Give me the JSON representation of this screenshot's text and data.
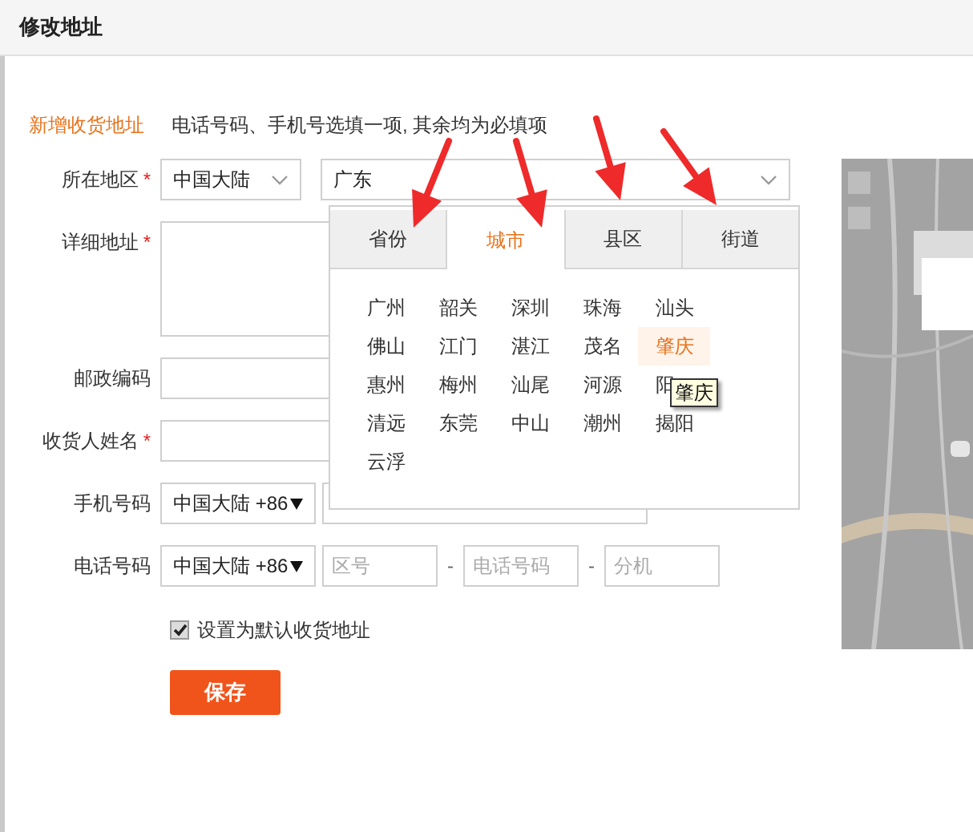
{
  "title": "修改地址",
  "note": {
    "label": "新增收货地址",
    "hint": "电话号码、手机号选填一项, 其余均为必填项"
  },
  "fields": [
    {
      "kind": "region",
      "label": "所在地区",
      "required_mark": "*",
      "country": "中国大陆",
      "province": "广东"
    },
    {
      "kind": "textarea",
      "label": "详细地址",
      "required_mark": "*"
    },
    {
      "kind": "text",
      "label": "邮政编码"
    },
    {
      "kind": "text",
      "label": "收货人姓名",
      "required_mark": "*"
    },
    {
      "kind": "phone",
      "label": "手机号码",
      "country": "中国大陆 +86"
    },
    {
      "kind": "tel",
      "label": "电话号码",
      "country": "中国大陆 +86",
      "placeholders": [
        "区号",
        "电话号码",
        "分机"
      ],
      "separators": [
        "-",
        "-"
      ]
    }
  ],
  "default_checkbox": {
    "label": "设置为默认收货地址",
    "checked": true
  },
  "save_button": "保存",
  "dropdown": {
    "tabs": [
      {
        "label": "省份",
        "selected": false
      },
      {
        "label": "城市",
        "selected": true
      },
      {
        "label": "县区",
        "selected": false
      },
      {
        "label": "街道",
        "selected": false
      }
    ],
    "cities": [
      {
        "label": "广州",
        "selected": false
      },
      {
        "label": "韶关",
        "selected": false
      },
      {
        "label": "深圳",
        "selected": false
      },
      {
        "label": "珠海",
        "selected": false
      },
      {
        "label": "汕头",
        "selected": false
      },
      {
        "label": "佛山",
        "selected": false
      },
      {
        "label": "江门",
        "selected": false
      },
      {
        "label": "湛江",
        "selected": false
      },
      {
        "label": "茂名",
        "selected": false
      },
      {
        "label": "肇庆",
        "selected": true
      },
      {
        "label": "惠州",
        "selected": false
      },
      {
        "label": "梅州",
        "selected": false
      },
      {
        "label": "汕尾",
        "selected": false
      },
      {
        "label": "河源",
        "selected": false
      },
      {
        "label": "阳",
        "selected": false
      },
      {
        "label": "清远",
        "selected": false
      },
      {
        "label": "东莞",
        "selected": false
      },
      {
        "label": "中山",
        "selected": false
      },
      {
        "label": "潮州",
        "selected": false
      },
      {
        "label": "揭阳",
        "selected": false
      },
      {
        "label": "云浮",
        "selected": false
      }
    ],
    "tooltip": "肇庆"
  }
}
